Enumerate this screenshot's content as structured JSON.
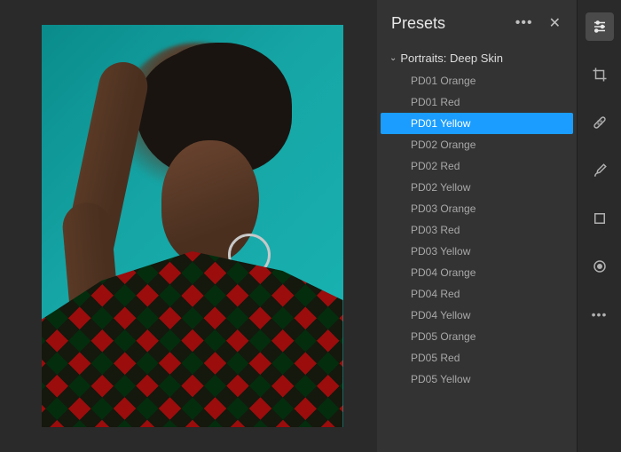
{
  "panel": {
    "title": "Presets",
    "group": {
      "name": "Portraits: Deep Skin",
      "expanded": true,
      "items": [
        {
          "label": "PD01 Orange",
          "selected": false
        },
        {
          "label": "PD01 Red",
          "selected": false
        },
        {
          "label": "PD01 Yellow",
          "selected": true
        },
        {
          "label": "PD02 Orange",
          "selected": false
        },
        {
          "label": "PD02 Red",
          "selected": false
        },
        {
          "label": "PD02 Yellow",
          "selected": false
        },
        {
          "label": "PD03 Orange",
          "selected": false
        },
        {
          "label": "PD03 Red",
          "selected": false
        },
        {
          "label": "PD03 Yellow",
          "selected": false
        },
        {
          "label": "PD04 Orange",
          "selected": false
        },
        {
          "label": "PD04 Red",
          "selected": false
        },
        {
          "label": "PD04 Yellow",
          "selected": false
        },
        {
          "label": "PD05 Orange",
          "selected": false
        },
        {
          "label": "PD05 Red",
          "selected": false
        },
        {
          "label": "PD05 Yellow",
          "selected": false
        }
      ]
    }
  },
  "toolbar": {
    "tools": [
      {
        "name": "edit-sliders",
        "active": true
      },
      {
        "name": "crop",
        "active": false
      },
      {
        "name": "healing",
        "active": false
      },
      {
        "name": "brush",
        "active": false
      },
      {
        "name": "linear-gradient",
        "active": false
      },
      {
        "name": "radial-gradient",
        "active": false
      },
      {
        "name": "more",
        "active": false
      }
    ]
  },
  "colors": {
    "selection": "#1a9dff",
    "panel_bg": "#333333",
    "app_bg": "#2a2a2a"
  }
}
